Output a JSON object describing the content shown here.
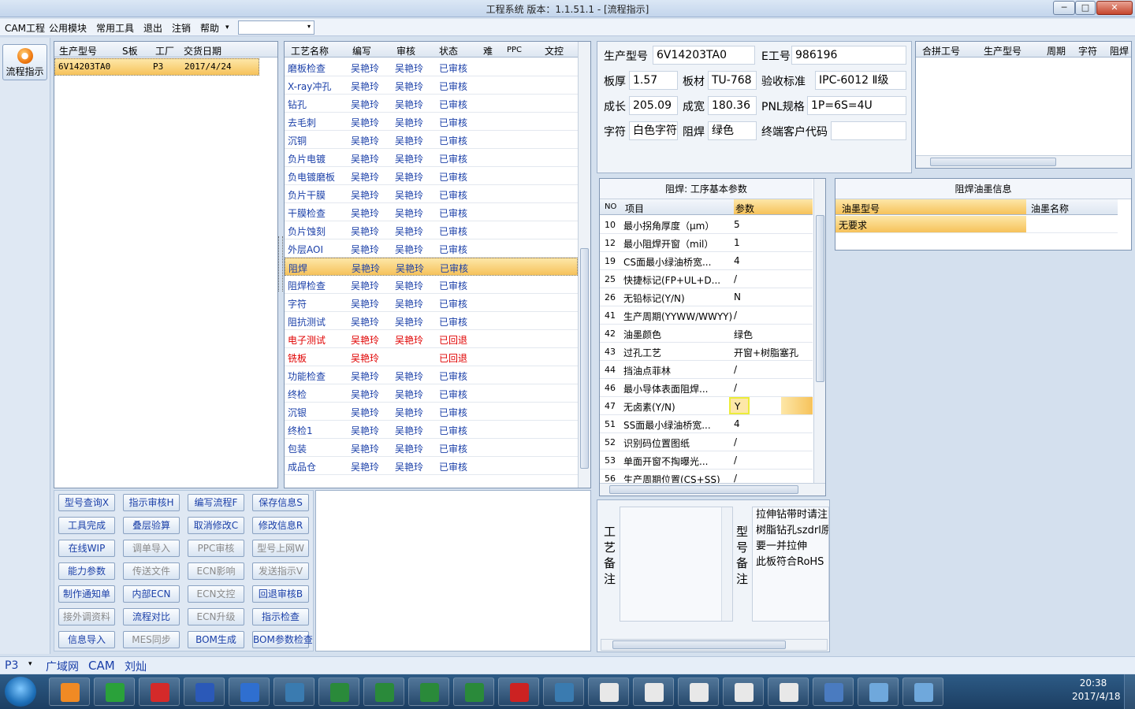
{
  "window": {
    "title": "工程系统   版本：1.1.51.1 - [流程指示]",
    "btn_min": "─",
    "btn_max": "□",
    "btn_close": "✕"
  },
  "menu": [
    "CAM工程",
    "公用模块",
    "常用工具",
    "退出",
    "注销",
    "帮助"
  ],
  "menu_arrow": "▾",
  "left": {
    "flow_label": "流程指示"
  },
  "job_list": {
    "headers": [
      "生产型号",
      "S板",
      "工厂",
      "交货日期"
    ],
    "rows": [
      {
        "model": "6V14203TA0",
        "s": "",
        "factory": "P3",
        "date": "2017/4/24"
      }
    ]
  },
  "process": {
    "headers": [
      "工艺名称",
      "编写",
      "审核",
      "状态",
      "难",
      "PPC",
      "文控"
    ],
    "rows": [
      {
        "name": "磨板检查",
        "writer": "吴艳玲",
        "auditor": "吴艳玲",
        "status": "已审核",
        "red": false
      },
      {
        "name": "X-ray冲孔",
        "writer": "吴艳玲",
        "auditor": "吴艳玲",
        "status": "已审核",
        "red": false
      },
      {
        "name": "钻孔",
        "writer": "吴艳玲",
        "auditor": "吴艳玲",
        "status": "已审核",
        "red": false
      },
      {
        "name": "去毛刺",
        "writer": "吴艳玲",
        "auditor": "吴艳玲",
        "status": "已审核",
        "red": false
      },
      {
        "name": "沉铜",
        "writer": "吴艳玲",
        "auditor": "吴艳玲",
        "status": "已审核",
        "red": false
      },
      {
        "name": "负片电镀",
        "writer": "吴艳玲",
        "auditor": "吴艳玲",
        "status": "已审核",
        "red": false
      },
      {
        "name": "负电镀磨板",
        "writer": "吴艳玲",
        "auditor": "吴艳玲",
        "status": "已审核",
        "red": false
      },
      {
        "name": "负片干膜",
        "writer": "吴艳玲",
        "auditor": "吴艳玲",
        "status": "已审核",
        "red": false
      },
      {
        "name": "干膜检查",
        "writer": "吴艳玲",
        "auditor": "吴艳玲",
        "status": "已审核",
        "red": false
      },
      {
        "name": "负片蚀刻",
        "writer": "吴艳玲",
        "auditor": "吴艳玲",
        "status": "已审核",
        "red": false
      },
      {
        "name": "外层AOI",
        "writer": "吴艳玲",
        "auditor": "吴艳玲",
        "status": "已审核",
        "red": false
      },
      {
        "name": "阻焊",
        "writer": "吴艳玲",
        "auditor": "吴艳玲",
        "status": "已审核",
        "red": false
      },
      {
        "name": "阻焊检查",
        "writer": "吴艳玲",
        "auditor": "吴艳玲",
        "status": "已审核",
        "red": false
      },
      {
        "name": "字符",
        "writer": "吴艳玲",
        "auditor": "吴艳玲",
        "status": "已审核",
        "red": false
      },
      {
        "name": "阻抗测试",
        "writer": "吴艳玲",
        "auditor": "吴艳玲",
        "status": "已审核",
        "red": false
      },
      {
        "name": "电子测试",
        "writer": "吴艳玲",
        "auditor": "吴艳玲",
        "status": "已回退",
        "red": true
      },
      {
        "name": "铣板",
        "writer": "吴艳玲",
        "auditor": "",
        "status": "已回退",
        "red": true
      },
      {
        "name": "功能检查",
        "writer": "吴艳玲",
        "auditor": "吴艳玲",
        "status": "已审核",
        "red": false
      },
      {
        "name": "终检",
        "writer": "吴艳玲",
        "auditor": "吴艳玲",
        "status": "已审核",
        "red": false
      },
      {
        "name": "沉银",
        "writer": "吴艳玲",
        "auditor": "吴艳玲",
        "status": "已审核",
        "red": false
      },
      {
        "name": "终检1",
        "writer": "吴艳玲",
        "auditor": "吴艳玲",
        "status": "已审核",
        "red": false
      },
      {
        "name": "包装",
        "writer": "吴艳玲",
        "auditor": "吴艳玲",
        "status": "已审核",
        "red": false
      },
      {
        "name": "成品仓",
        "writer": "吴艳玲",
        "auditor": "吴艳玲",
        "status": "已审核",
        "red": false
      }
    ]
  },
  "buttons": [
    [
      "型号查询X",
      "指示审核H",
      "编写流程F",
      "保存信息S"
    ],
    [
      "工具完成",
      "叠层验算",
      "取消修改C",
      "修改信息R"
    ],
    [
      "在线WIP",
      "调单导入",
      "PPC审核",
      "型号上网W"
    ],
    [
      "能力参数",
      "传送文件",
      "ECN影响",
      "发送指示V"
    ],
    [
      "制作通知单",
      "内部ECN",
      "ECN文控",
      "回退审核B"
    ],
    [
      "接外调资料",
      "流程对比",
      "ECN升级",
      "指示检查"
    ],
    [
      "信息导入",
      "MES同步",
      "BOM生成",
      "BOM参数检查"
    ]
  ],
  "info": {
    "labels": [
      "生产型号",
      "E工号",
      "板厚",
      "板材",
      "验收标准",
      "成长",
      "成宽",
      "PNL规格",
      "字符",
      "阻焊",
      "终端客户代码"
    ],
    "model": "6V14203TA0",
    "e_no": "986196",
    "thickness": "1.57",
    "material": "TU-768",
    "standard": "IPC-6012 Ⅱ级",
    "length": "205.09",
    "width": "180.36",
    "pnl": "1P=6S=4U",
    "char": "白色字符",
    "mask": "绿色",
    "customer": ""
  },
  "combine": {
    "headers": [
      "合拼工号",
      "生产型号",
      "周期",
      "字符",
      "阻焊"
    ]
  },
  "params": {
    "title": "阻焊: 工序基本参数",
    "headers": [
      "NO",
      "项目",
      "参数"
    ],
    "rows": [
      {
        "no": "10",
        "item": "最小拐角厚度（μm）",
        "val": "5"
      },
      {
        "no": "12",
        "item": "最小阻焊开窗（mil）",
        "val": "1"
      },
      {
        "no": "19",
        "item": "CS面最小绿油桥宽...",
        "val": "4"
      },
      {
        "no": "25",
        "item": "快捷标记(FP+UL+D...",
        "val": "/"
      },
      {
        "no": "26",
        "item": "无铅标记(Y/N)",
        "val": "N"
      },
      {
        "no": "41",
        "item": "生产周期(YYWW/WWYY)",
        "val": "/"
      },
      {
        "no": "42",
        "item": "油墨颜色",
        "val": "绿色"
      },
      {
        "no": "43",
        "item": "过孔工艺",
        "val": "开窗+树脂塞孔"
      },
      {
        "no": "44",
        "item": "挡油点菲林",
        "val": "/"
      },
      {
        "no": "46",
        "item": "最小导体表面阻焊...",
        "val": "/"
      },
      {
        "no": "47",
        "item": "无卤素(Y/N)",
        "val": "Y"
      },
      {
        "no": "51",
        "item": "SS面最小绿油桥宽...",
        "val": "4"
      },
      {
        "no": "52",
        "item": "识别码位置图纸",
        "val": "/"
      },
      {
        "no": "53",
        "item": "单面开窗不掏曝光...",
        "val": "/"
      },
      {
        "no": "56",
        "item": "生产周期位置(CS+SS)",
        "val": "/"
      }
    ]
  },
  "ink": {
    "title": "阻焊油墨信息",
    "headers": [
      "油墨型号",
      "油墨名称"
    ],
    "rows": [
      {
        "type": "无要求",
        "name": ""
      }
    ]
  },
  "notes": {
    "craft_label": [
      "工",
      "艺",
      "备",
      "注"
    ],
    "model_label": [
      "型",
      "号",
      "备",
      "注"
    ],
    "model_text": [
      "拉伸钻带时请注",
      "树脂钻孔szdrl原",
      "要一并拉伸",
      "此板符合RoHS"
    ]
  },
  "status": {
    "factory": "P3",
    "net": "广域网",
    "mode": "CAM",
    "user": "刘灿"
  },
  "clock": {
    "time": "20:38",
    "date": "2017/4/18"
  },
  "colors": {
    "accent": "#f6c25a",
    "blue_text": "#1a3fa8",
    "red_text": "#e00000"
  }
}
